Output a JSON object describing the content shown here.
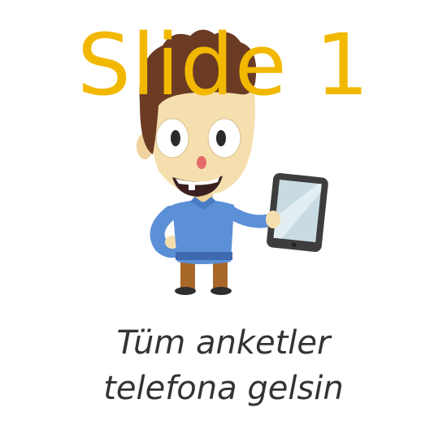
{
  "slide": {
    "title": "Slide 1",
    "title_color": "#f2b800"
  },
  "tagline": {
    "line1": "Tüm anketler",
    "line2": "telefona gelsin"
  },
  "illustration": {
    "icon": "cartoon-man-holding-tablet-icon",
    "colors": {
      "skin": "#f6dfae",
      "hair": "#6b3b24",
      "shirt": "#5b8fd6",
      "pants": "#a8682a",
      "tablet_body": "#3d3d3d",
      "tablet_screen": "#c9dbe2"
    }
  }
}
